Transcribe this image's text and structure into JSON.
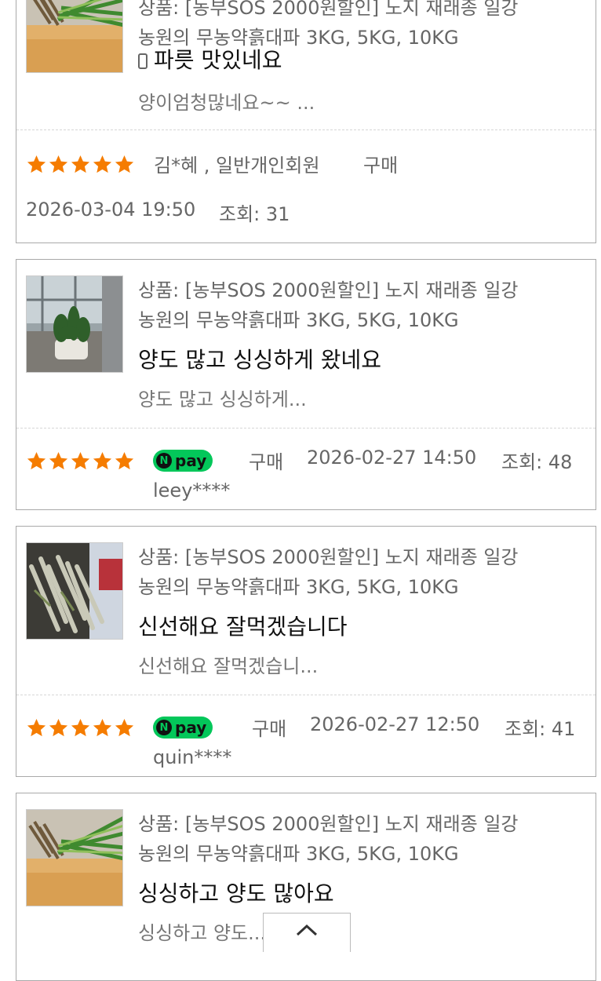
{
  "accent": {
    "star": "#f57c00",
    "npay": "#03c75a"
  },
  "reviews": [
    {
      "product_line1": "상품: [농부SOS 2000원할인] 노지 재래종 일강",
      "product_line2": "농원의 무농약흙대파 3KG, 5KG, 10KG",
      "title": "파릇 맛있네요",
      "preview": "양이엄청많네요~~ ...",
      "author": "김*혜 , 일반개인회원",
      "purchase": "구매",
      "date": "2026-03-04 19:50",
      "views": "조회: 31",
      "rating": 5,
      "mobile_icon": "mobile-phone-icon"
    },
    {
      "product_line1": "상품: [농부SOS 2000원할인] 노지 재래종 일강",
      "product_line2": "농원의 무농약흙대파 3KG, 5KG, 10KG",
      "title": "양도 많고 싱싱하게 왔네요",
      "preview": "양도 많고 싱싱하게...",
      "badge": "pay",
      "purchase": "구매",
      "date": "2026-02-27 14:50",
      "views": "조회: 48",
      "author": "leey****",
      "rating": 5
    },
    {
      "product_line1": "상품: [농부SOS 2000원할인] 노지 재래종 일강",
      "product_line2": "농원의 무농약흙대파 3KG, 5KG, 10KG",
      "title": "신선해요 잘먹겠습니다",
      "preview": "신선해요 잘먹겠습니...",
      "badge": "pay",
      "purchase": "구매",
      "date": "2026-02-27 12:50",
      "views": "조회: 41",
      "author": "quin****",
      "rating": 5
    },
    {
      "product_line1": "상품: [농부SOS 2000원할인] 노지 재래종 일강",
      "product_line2": "농원의 무농약흙대파 3KG, 5KG, 10KG",
      "title": "싱싱하고 양도 많아요",
      "preview": "싱싱하고 양도..."
    }
  ],
  "scroll_top_icon": "chevron-up-icon"
}
